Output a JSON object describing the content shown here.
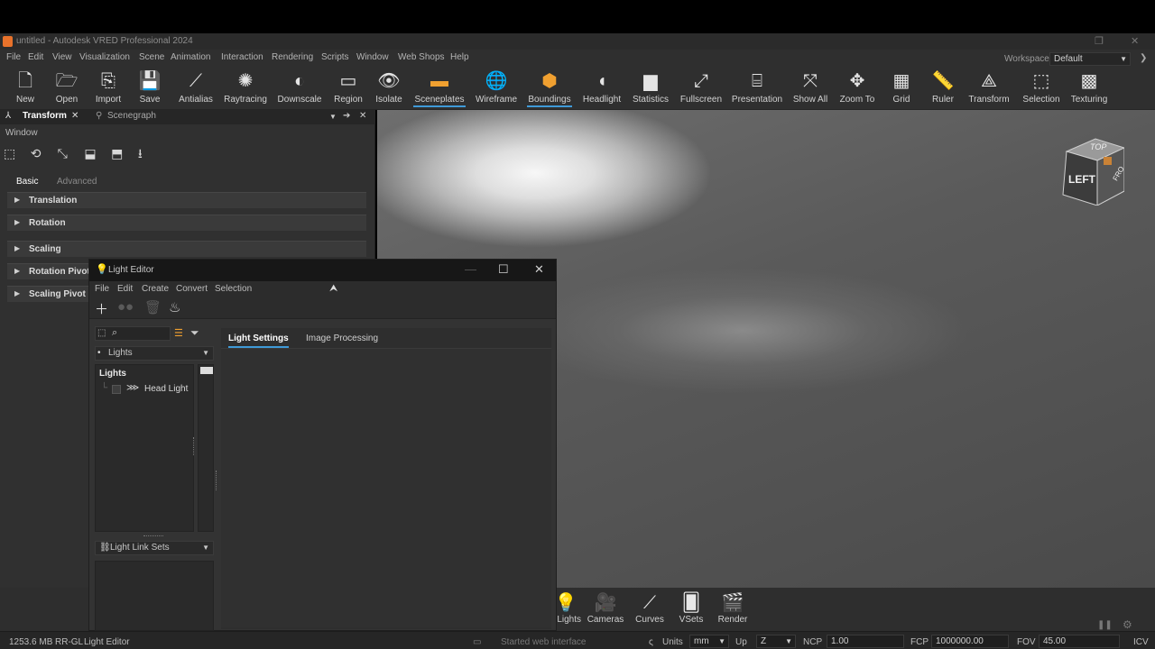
{
  "titlebar": {
    "title": "untitled - Autodesk VRED Professional 2024"
  },
  "menu": [
    "File",
    "Edit",
    "View",
    "Visualization",
    "Scene",
    "Animation",
    "Interaction",
    "Rendering",
    "Scripts",
    "Window",
    "Web Shops",
    "Help"
  ],
  "workspace": {
    "label": "Workspace",
    "value": "Default"
  },
  "toolbar": {
    "new": "New",
    "open": "Open",
    "import": "Import",
    "save": "Save",
    "antialias": "Antialias",
    "raytracing": "Raytracing",
    "downscale": "Downscale",
    "region": "Region",
    "isolate": "Isolate",
    "sceneplates": "Sceneplates",
    "wireframe": "Wireframe",
    "boundings": "Boundings",
    "headlight": "Headlight",
    "statistics": "Statistics",
    "fullscreen": "Fullscreen",
    "presentation": "Presentation",
    "showall": "Show All",
    "zoomto": "Zoom To",
    "grid": "Grid",
    "ruler": "Ruler",
    "transform": "Transform",
    "selection": "Selection",
    "texturing": "Texturing"
  },
  "leftpanel": {
    "tab_transform": "Transform",
    "tab_scenegraph": "Scenegraph",
    "window_label": "Window",
    "subtab_basic": "Basic",
    "subtab_advanced": "Advanced",
    "sections": [
      "Translation",
      "Rotation",
      "Scaling",
      "Rotation Pivot",
      "Scaling Pivot"
    ]
  },
  "navcube": {
    "top": "TOP",
    "left": "LEFT",
    "front": "FRO"
  },
  "light_editor": {
    "title": "Light Editor",
    "menu": [
      "File",
      "Edit",
      "Create",
      "Convert",
      "Selection"
    ],
    "lights_dropdown": "Lights",
    "tree_header": "Lights",
    "tree_items": [
      "Head Light"
    ],
    "link_sets": "Light Link Sets",
    "tab_light_settings": "Light Settings",
    "tab_image_processing": "Image Processing"
  },
  "dock": {
    "lights": "Lights",
    "cameras": "Cameras",
    "curves": "Curves",
    "vsets": "VSets",
    "render": "Render"
  },
  "status": {
    "memory": "1253.6 MB",
    "renderer": "RR-GL",
    "module": "Light Editor",
    "message": "Started web interface",
    "units_label": "Units",
    "units_value": "mm",
    "up_label": "Up",
    "up_value": "Z",
    "ncp_label": "NCP",
    "ncp_value": "1.00",
    "fcp_label": "FCP",
    "fcp_value": "1000000.00",
    "fov_label": "FOV",
    "fov_value": "45.00",
    "icv": "ICV"
  }
}
